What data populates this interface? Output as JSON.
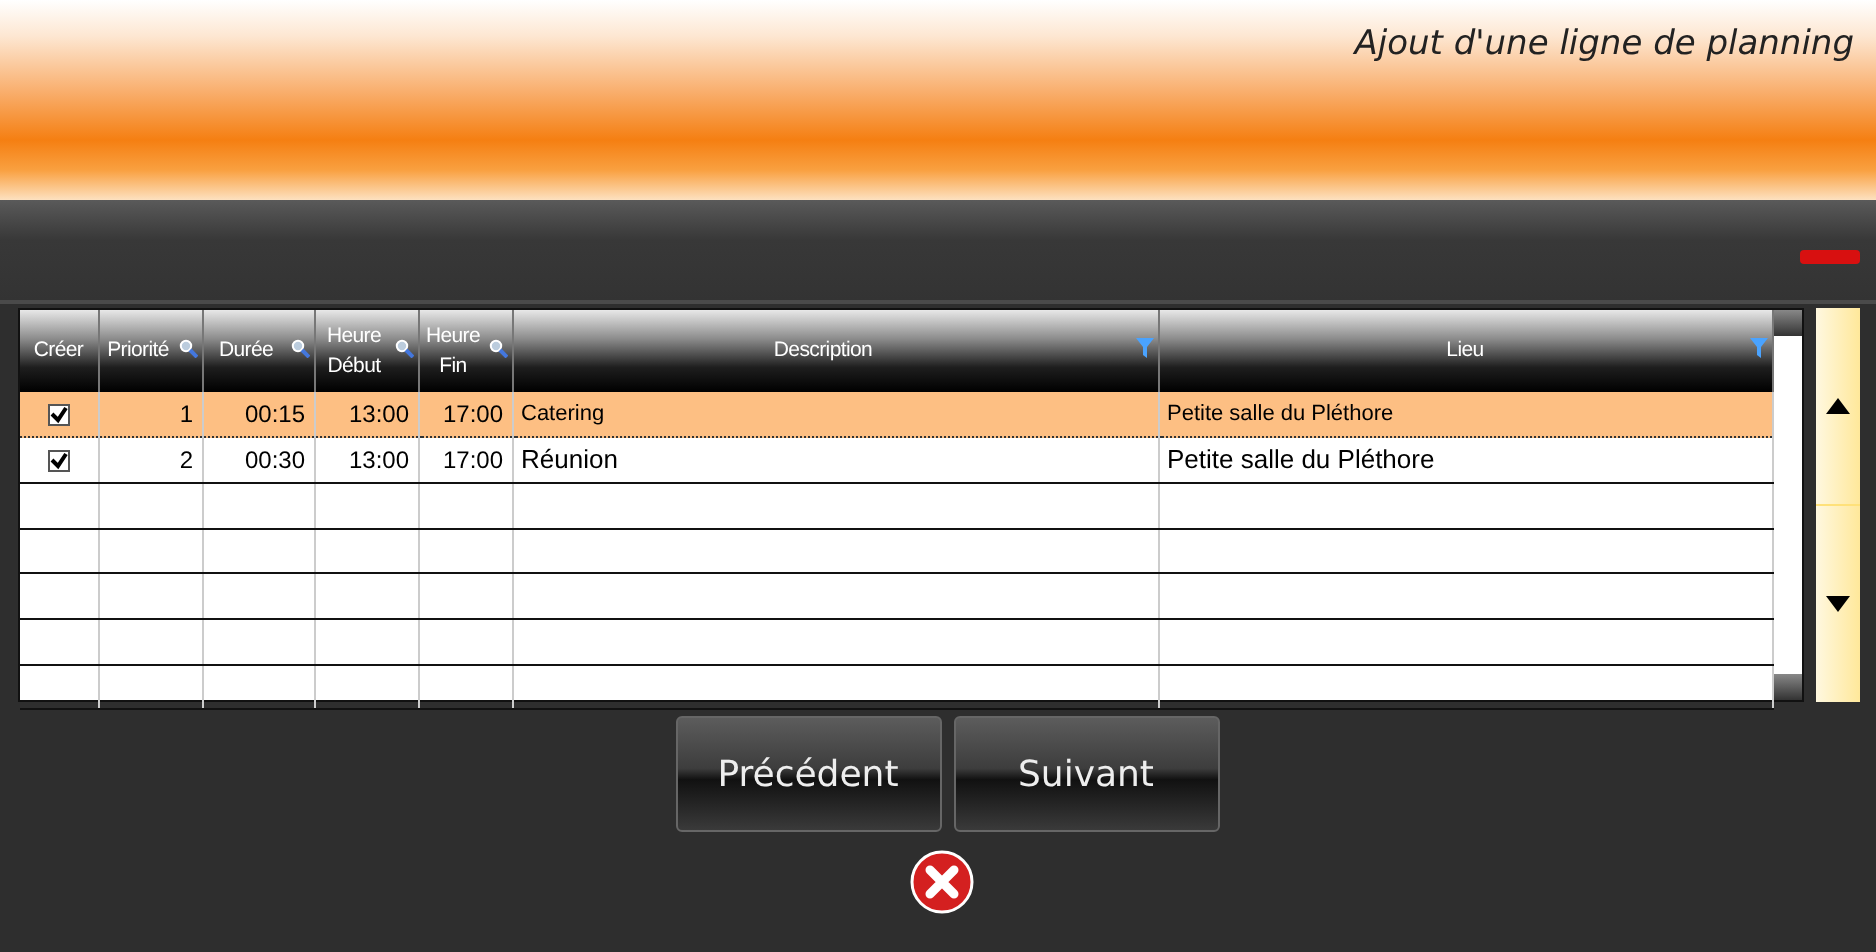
{
  "window": {
    "title": "Ajout d'une ligne de planning"
  },
  "table": {
    "columns": [
      {
        "label": "Créer",
        "kind": "plain"
      },
      {
        "label": "Priorité",
        "kind": "search"
      },
      {
        "label": "Durée",
        "kind": "search"
      },
      {
        "label": "Heure Début",
        "kind": "search"
      },
      {
        "label": "Heure Fin",
        "kind": "search"
      },
      {
        "label": "Description",
        "kind": "filter"
      },
      {
        "label": "Lieu",
        "kind": "filter"
      }
    ],
    "rows": [
      {
        "selected": true,
        "cells": [
          {
            "kind": "check",
            "checked": true
          },
          {
            "kind": "text",
            "text": "1"
          },
          {
            "kind": "text",
            "text": "00:15"
          },
          {
            "kind": "text",
            "text": "13:00"
          },
          {
            "kind": "text",
            "text": "17:00"
          },
          {
            "kind": "text",
            "text": "Catering"
          },
          {
            "kind": "text",
            "text": "Petite salle du Pléthore"
          }
        ]
      },
      {
        "selected": false,
        "cells": [
          {
            "kind": "check",
            "checked": true
          },
          {
            "kind": "text",
            "text": "2"
          },
          {
            "kind": "text",
            "text": "00:30"
          },
          {
            "kind": "text",
            "text": "13:00"
          },
          {
            "kind": "text",
            "text": "17:00"
          },
          {
            "kind": "text",
            "text": "Réunion"
          },
          {
            "kind": "text",
            "text": "Petite salle du Pléthore"
          }
        ]
      }
    ]
  },
  "buttons": [
    "Précédent",
    "Suivant"
  ]
}
